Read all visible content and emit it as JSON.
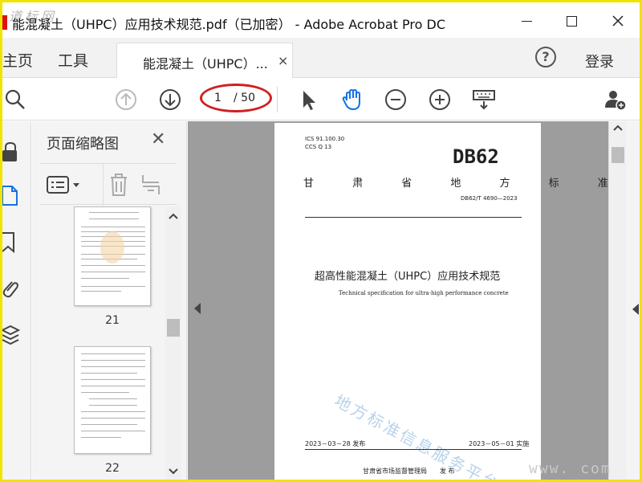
{
  "window": {
    "title": "能混凝土（UHPC）应用技术规范.pdf（已加密） - Adobe Acrobat Pro DC",
    "watermark_top": "道标网"
  },
  "menubar": {
    "home": "主页",
    "tools": "工具",
    "tab_label": "能混凝土（UHPC）...",
    "tab_close": "×",
    "help": "?",
    "login": "登录"
  },
  "toolbar": {
    "page_current": "1",
    "page_total": "/ 50"
  },
  "thumbnails": {
    "panel_title": "页面缩略图",
    "close": "✕",
    "pages": [
      {
        "label": "21"
      },
      {
        "label": "22"
      }
    ]
  },
  "document": {
    "ics": "ICS  91.100.30",
    "ccs": "CCS  Q 13",
    "code": "DB62",
    "province": "甘 肃 省 地 方 标 准",
    "number": "DB62/T 4690—2023",
    "title_cn": "超高性能混凝土（UHPC）应用技术规范",
    "title_en": "Technical specification for ultra-high performance concrete",
    "watermark": "地方标准信息服务平台",
    "date_issue": "2023－03－28 发布",
    "date_impl": "2023－05－01 实施",
    "publisher": "甘肃省市场监督管理局　　发 布"
  },
  "watermark_bottom": "www.    com",
  "colors": {
    "accent_blue": "#1473e6",
    "oval_red": "#d02020",
    "frame_yellow": "#f1e400",
    "doc_bg": "#9d9d9d"
  }
}
